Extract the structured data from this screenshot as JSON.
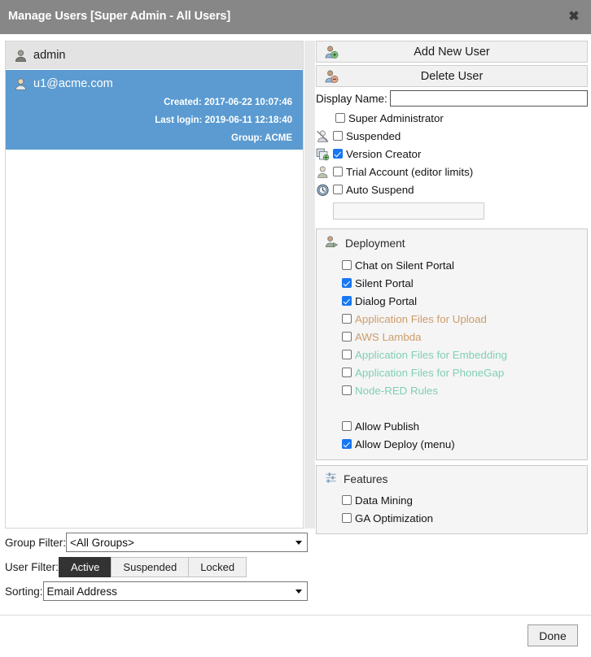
{
  "window": {
    "title": "Manage Users [Super Admin - All Users]",
    "close_icon": "close-icon",
    "close_glyph": "✖"
  },
  "colors": {
    "titlebar": "#878787",
    "selection": "#5b9bd1",
    "row_alt": "#e3e3e3",
    "orange_label": "#cc9c6b",
    "green_label": "#80cfb4",
    "accent_checkbox": "#1877f2",
    "segment_active": "#333333"
  },
  "user_list": {
    "rows": [
      {
        "name": "admin",
        "icon": "user-icon",
        "selected": false,
        "created": "",
        "last_login": "",
        "group": ""
      },
      {
        "name": "u1@acme.com",
        "icon": "user-icon",
        "selected": true,
        "created": "Created: 2017-06-22 10:07:46",
        "last_login": "Last login: 2019-06-11 12:18:40",
        "group": "Group: ACME"
      }
    ]
  },
  "filters": {
    "group_filter": {
      "label": "Group Filter:",
      "value": "<All Groups>",
      "options": [
        "<All Groups>"
      ]
    },
    "user_filter": {
      "label": "User Filter:",
      "segments": [
        {
          "label": "Active",
          "active": true
        },
        {
          "label": "Suspended",
          "active": false
        },
        {
          "label": "Locked",
          "active": false
        }
      ]
    },
    "sorting": {
      "label": "Sorting:",
      "value": "Email Address",
      "options": [
        "Email Address"
      ]
    }
  },
  "actions": {
    "add_user": {
      "label": "Add New User",
      "icon": "user-add-icon"
    },
    "delete_user": {
      "label": "Delete User",
      "icon": "user-delete-icon"
    }
  },
  "details": {
    "display_name": {
      "label": "Display Name:",
      "value": "",
      "placeholder": ""
    },
    "flags": [
      {
        "label": "Super Administrator",
        "checked": false,
        "icon": ""
      },
      {
        "label": "Suspended",
        "checked": false,
        "icon": "user-suspended-icon"
      },
      {
        "label": "Version Creator",
        "checked": true,
        "icon": "version-icon"
      },
      {
        "label": "Trial Account (editor limits)",
        "checked": false,
        "icon": "user-trial-icon"
      },
      {
        "label": "Auto Suspend",
        "checked": false,
        "icon": "clock-icon"
      }
    ],
    "auto_suspend_value": {
      "value": "",
      "placeholder": ""
    }
  },
  "deployment": {
    "title": "Deployment",
    "icon": "deployment-icon",
    "items": [
      {
        "label": "Chat on Silent Portal",
        "checked": false,
        "style": "normal"
      },
      {
        "label": "Silent Portal",
        "checked": true,
        "style": "normal"
      },
      {
        "label": "Dialog Portal",
        "checked": true,
        "style": "normal"
      },
      {
        "label": "Application Files for Upload",
        "checked": false,
        "style": "orange"
      },
      {
        "label": "AWS Lambda",
        "checked": false,
        "style": "orange"
      },
      {
        "label": "Application Files for Embedding",
        "checked": false,
        "style": "green"
      },
      {
        "label": "Application Files for PhoneGap",
        "checked": false,
        "style": "green"
      },
      {
        "label": "Node-RED Rules",
        "checked": false,
        "style": "green"
      }
    ],
    "permissions": [
      {
        "label": "Allow Publish",
        "checked": false,
        "style": "normal"
      },
      {
        "label": "Allow Deploy (menu)",
        "checked": true,
        "style": "normal"
      }
    ]
  },
  "features": {
    "title": "Features",
    "icon": "sliders-icon",
    "items": [
      {
        "label": "Data Mining",
        "checked": false,
        "style": "normal"
      },
      {
        "label": "GA Optimization",
        "checked": false,
        "style": "normal"
      }
    ]
  },
  "footer": {
    "done_label": "Done"
  }
}
